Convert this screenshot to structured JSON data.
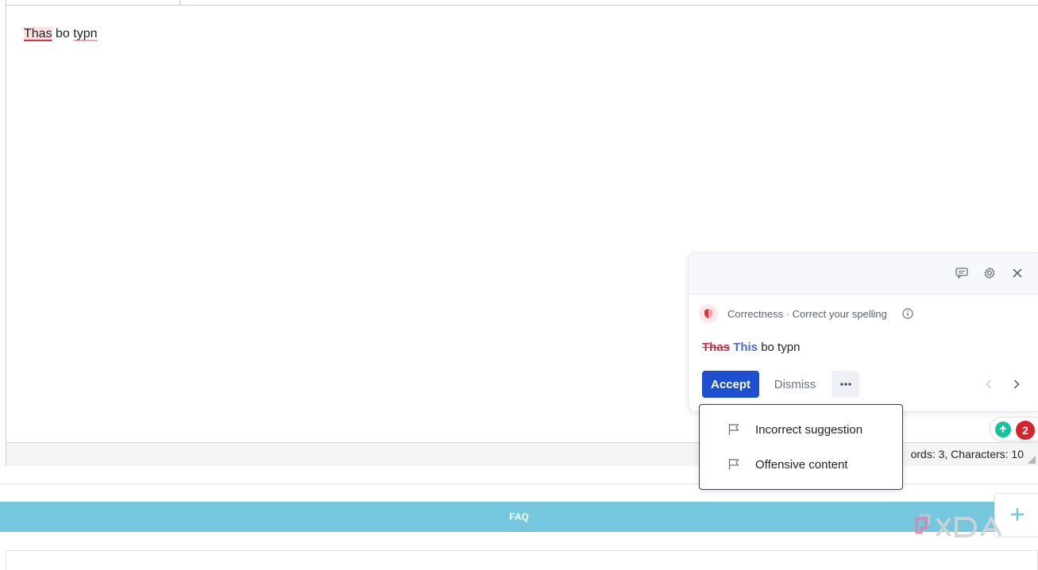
{
  "editor": {
    "words": [
      {
        "text": "Thas",
        "style": "error-highlight"
      },
      {
        "text": "bo",
        "style": "plain"
      },
      {
        "text": "typn",
        "style": "error-soft"
      }
    ],
    "status_text": "ords: 3, Characters: 10"
  },
  "footer": {
    "faq_label": "FAQ"
  },
  "card": {
    "category_text": "Correctness · Correct your spelling",
    "suggestion": {
      "strike": "Thas",
      "replacement": "This",
      "rest": "bo typn"
    },
    "accept_label": "Accept",
    "dismiss_label": "Dismiss",
    "icons": [
      "feedback-icon",
      "settings-icon",
      "close-icon",
      "info-icon",
      "more-icon",
      "chevron-left-icon",
      "chevron-right-icon"
    ]
  },
  "menu": {
    "items": [
      {
        "label": "Incorrect suggestion",
        "icon": "flag-icon"
      },
      {
        "label": "Offensive content",
        "icon": "flag-icon"
      }
    ]
  },
  "widget": {
    "issue_count": "2"
  },
  "colors": {
    "accent": "#1f4fd1",
    "error": "#d7263d",
    "replacement": "#4b6ad6",
    "faq_bar": "#74c7dc",
    "grammarly_green": "#15c39a",
    "badge_red": "#d8222e"
  }
}
